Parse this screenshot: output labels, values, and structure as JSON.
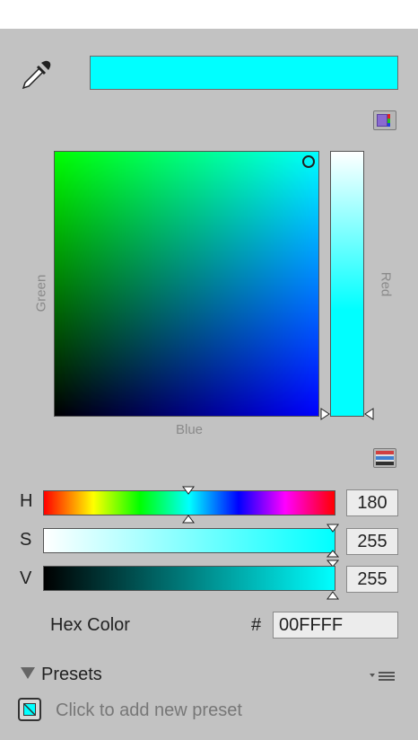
{
  "color_picker": {
    "current_color": "#00FFFF",
    "eyedropper_icon": "eyedropper-icon",
    "slider_mode_icon": "color-picker-mode-icon",
    "slider_type_icon": "slider-type-icon",
    "axis_labels": {
      "vertical_left": "Green",
      "vertical_right": "Red",
      "bottom": "Blue"
    }
  },
  "sliders": [
    {
      "label": "H",
      "value": "180",
      "fraction": 0.5
    },
    {
      "label": "S",
      "value": "255",
      "fraction": 1.0
    },
    {
      "label": "V",
      "value": "255",
      "fraction": 1.0
    }
  ],
  "hex": {
    "label": "Hex Color",
    "prefix": "#",
    "value": "00FFFF"
  },
  "presets": {
    "title": "Presets",
    "add_text": "Click to add new preset",
    "menu_icon": "list-menu-icon",
    "expanded_icon": "triangle-down-icon"
  }
}
